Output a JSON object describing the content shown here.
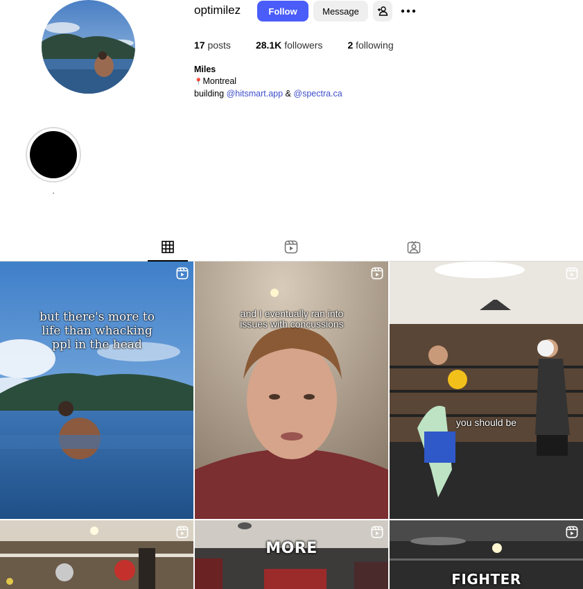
{
  "profile": {
    "username": "optimilez",
    "follow_label": "Follow",
    "message_label": "Message",
    "stats": {
      "posts_count": "17",
      "posts_label": "posts",
      "followers_count": "28.1K",
      "followers_label": "followers",
      "following_count": "2",
      "following_label": "following"
    },
    "bio": {
      "name": "Miles",
      "location_pin": "📍",
      "location": "Montreal",
      "building_text": "building",
      "link1": "@hitsmart.app",
      "ampersand": "&",
      "link2": "@spectra.ca"
    }
  },
  "highlights": [
    {
      "label": "."
    }
  ],
  "tabs": [
    {
      "icon": "grid-icon",
      "active": true
    },
    {
      "icon": "reels-icon",
      "active": false
    },
    {
      "icon": "tagged-icon",
      "active": false
    }
  ],
  "posts": [
    {
      "type": "reel",
      "caption": "but there's more to life than whacking ppl in the head"
    },
    {
      "type": "reel",
      "caption": "and I eventually ran into issues with concussions"
    },
    {
      "type": "reel",
      "caption": "you should be"
    },
    {
      "type": "reel",
      "caption": ""
    },
    {
      "type": "reel",
      "caption": "MORE"
    },
    {
      "type": "reel",
      "caption": "FIGHTER"
    }
  ],
  "colors": {
    "follow_button": "#4a5df9",
    "secondary_button": "#efefef",
    "link": "#3d4fcb",
    "border": "#dbdbdb"
  }
}
